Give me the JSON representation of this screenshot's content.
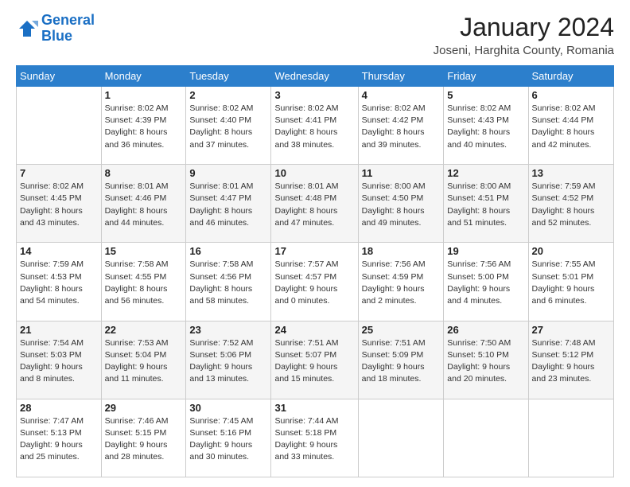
{
  "logo": {
    "line1": "General",
    "line2": "Blue"
  },
  "title": "January 2024",
  "location": "Joseni, Harghita County, Romania",
  "days_header": [
    "Sunday",
    "Monday",
    "Tuesday",
    "Wednesday",
    "Thursday",
    "Friday",
    "Saturday"
  ],
  "weeks": [
    [
      {
        "num": "",
        "info": ""
      },
      {
        "num": "1",
        "info": "Sunrise: 8:02 AM\nSunset: 4:39 PM\nDaylight: 8 hours\nand 36 minutes."
      },
      {
        "num": "2",
        "info": "Sunrise: 8:02 AM\nSunset: 4:40 PM\nDaylight: 8 hours\nand 37 minutes."
      },
      {
        "num": "3",
        "info": "Sunrise: 8:02 AM\nSunset: 4:41 PM\nDaylight: 8 hours\nand 38 minutes."
      },
      {
        "num": "4",
        "info": "Sunrise: 8:02 AM\nSunset: 4:42 PM\nDaylight: 8 hours\nand 39 minutes."
      },
      {
        "num": "5",
        "info": "Sunrise: 8:02 AM\nSunset: 4:43 PM\nDaylight: 8 hours\nand 40 minutes."
      },
      {
        "num": "6",
        "info": "Sunrise: 8:02 AM\nSunset: 4:44 PM\nDaylight: 8 hours\nand 42 minutes."
      }
    ],
    [
      {
        "num": "7",
        "info": "Sunrise: 8:02 AM\nSunset: 4:45 PM\nDaylight: 8 hours\nand 43 minutes."
      },
      {
        "num": "8",
        "info": "Sunrise: 8:01 AM\nSunset: 4:46 PM\nDaylight: 8 hours\nand 44 minutes."
      },
      {
        "num": "9",
        "info": "Sunrise: 8:01 AM\nSunset: 4:47 PM\nDaylight: 8 hours\nand 46 minutes."
      },
      {
        "num": "10",
        "info": "Sunrise: 8:01 AM\nSunset: 4:48 PM\nDaylight: 8 hours\nand 47 minutes."
      },
      {
        "num": "11",
        "info": "Sunrise: 8:00 AM\nSunset: 4:50 PM\nDaylight: 8 hours\nand 49 minutes."
      },
      {
        "num": "12",
        "info": "Sunrise: 8:00 AM\nSunset: 4:51 PM\nDaylight: 8 hours\nand 51 minutes."
      },
      {
        "num": "13",
        "info": "Sunrise: 7:59 AM\nSunset: 4:52 PM\nDaylight: 8 hours\nand 52 minutes."
      }
    ],
    [
      {
        "num": "14",
        "info": "Sunrise: 7:59 AM\nSunset: 4:53 PM\nDaylight: 8 hours\nand 54 minutes."
      },
      {
        "num": "15",
        "info": "Sunrise: 7:58 AM\nSunset: 4:55 PM\nDaylight: 8 hours\nand 56 minutes."
      },
      {
        "num": "16",
        "info": "Sunrise: 7:58 AM\nSunset: 4:56 PM\nDaylight: 8 hours\nand 58 minutes."
      },
      {
        "num": "17",
        "info": "Sunrise: 7:57 AM\nSunset: 4:57 PM\nDaylight: 9 hours\nand 0 minutes."
      },
      {
        "num": "18",
        "info": "Sunrise: 7:56 AM\nSunset: 4:59 PM\nDaylight: 9 hours\nand 2 minutes."
      },
      {
        "num": "19",
        "info": "Sunrise: 7:56 AM\nSunset: 5:00 PM\nDaylight: 9 hours\nand 4 minutes."
      },
      {
        "num": "20",
        "info": "Sunrise: 7:55 AM\nSunset: 5:01 PM\nDaylight: 9 hours\nand 6 minutes."
      }
    ],
    [
      {
        "num": "21",
        "info": "Sunrise: 7:54 AM\nSunset: 5:03 PM\nDaylight: 9 hours\nand 8 minutes."
      },
      {
        "num": "22",
        "info": "Sunrise: 7:53 AM\nSunset: 5:04 PM\nDaylight: 9 hours\nand 11 minutes."
      },
      {
        "num": "23",
        "info": "Sunrise: 7:52 AM\nSunset: 5:06 PM\nDaylight: 9 hours\nand 13 minutes."
      },
      {
        "num": "24",
        "info": "Sunrise: 7:51 AM\nSunset: 5:07 PM\nDaylight: 9 hours\nand 15 minutes."
      },
      {
        "num": "25",
        "info": "Sunrise: 7:51 AM\nSunset: 5:09 PM\nDaylight: 9 hours\nand 18 minutes."
      },
      {
        "num": "26",
        "info": "Sunrise: 7:50 AM\nSunset: 5:10 PM\nDaylight: 9 hours\nand 20 minutes."
      },
      {
        "num": "27",
        "info": "Sunrise: 7:48 AM\nSunset: 5:12 PM\nDaylight: 9 hours\nand 23 minutes."
      }
    ],
    [
      {
        "num": "28",
        "info": "Sunrise: 7:47 AM\nSunset: 5:13 PM\nDaylight: 9 hours\nand 25 minutes."
      },
      {
        "num": "29",
        "info": "Sunrise: 7:46 AM\nSunset: 5:15 PM\nDaylight: 9 hours\nand 28 minutes."
      },
      {
        "num": "30",
        "info": "Sunrise: 7:45 AM\nSunset: 5:16 PM\nDaylight: 9 hours\nand 30 minutes."
      },
      {
        "num": "31",
        "info": "Sunrise: 7:44 AM\nSunset: 5:18 PM\nDaylight: 9 hours\nand 33 minutes."
      },
      {
        "num": "",
        "info": ""
      },
      {
        "num": "",
        "info": ""
      },
      {
        "num": "",
        "info": ""
      }
    ]
  ]
}
